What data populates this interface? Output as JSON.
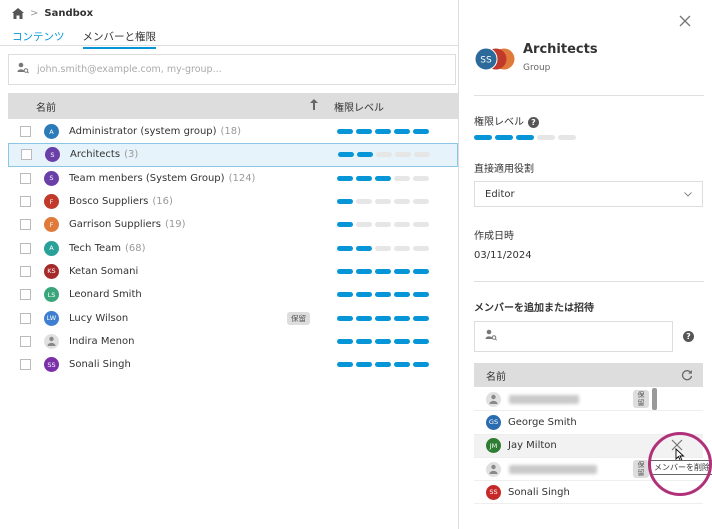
{
  "breadcrumb": {
    "current": "Sandbox"
  },
  "tabs": [
    {
      "label": "コンテンツ"
    },
    {
      "label": "メンバーと権限"
    }
  ],
  "search": {
    "placeholder": "john.smith@example.com, my-group..."
  },
  "table": {
    "col_name": "名前",
    "col_permission": "権限レベル",
    "rows": [
      {
        "initials": "A",
        "name": "Administrator (system group)",
        "count": "(18)",
        "avatar_color": "#2b7bb9",
        "group": true,
        "level": 5,
        "tag": ""
      },
      {
        "initials": "S",
        "name": "Architects",
        "count": "(3)",
        "avatar_color": "#6a3fa8",
        "group": true,
        "level": 2,
        "tag": ""
      },
      {
        "initials": "S",
        "name": "Team menbers (System Group)",
        "count": "(124)",
        "avatar_color": "#6a3fa8",
        "group": true,
        "level": 3,
        "tag": ""
      },
      {
        "initials": "F",
        "name": "Bosco Suppliers",
        "count": "(16)",
        "avatar_color": "#c0392b",
        "group": true,
        "level": 1,
        "tag": ""
      },
      {
        "initials": "F",
        "name": "Garrison Suppliers",
        "count": "(19)",
        "avatar_color": "#e07a3a",
        "group": true,
        "level": 1,
        "tag": ""
      },
      {
        "initials": "A",
        "name": "Tech Team",
        "count": "(68)",
        "avatar_color": "#2aa198",
        "group": true,
        "level": 2,
        "tag": ""
      },
      {
        "initials": "KS",
        "name": "Ketan Somani",
        "count": "",
        "avatar_color": "#a52a2a",
        "group": false,
        "level": 5,
        "tag": ""
      },
      {
        "initials": "LS",
        "name": "Leonard Smith",
        "count": "",
        "avatar_color": "#3aa57a",
        "group": false,
        "level": 5,
        "tag": ""
      },
      {
        "initials": "LW",
        "name": "Lucy Wilson",
        "count": "",
        "avatar_color": "#3f7fd1",
        "group": false,
        "level": 5,
        "tag": "保留"
      },
      {
        "initials": "",
        "name": "Indira Menon",
        "count": "",
        "avatar_color": "#e0e0e0",
        "group": false,
        "level": 5,
        "tag": ""
      },
      {
        "initials": "SS",
        "name": "Sonali Singh",
        "count": "",
        "avatar_color": "#7b2fa8",
        "group": false,
        "level": 5,
        "tag": ""
      }
    ]
  },
  "panel": {
    "title": "Architects",
    "subtitle": "Group",
    "avatar_initials": "SS",
    "permission_label": "権限レベル",
    "permission_level": 3,
    "role_label": "直接適用役割",
    "role_value": "Editor",
    "created_label": "作成日時",
    "created_value": "03/11/2024",
    "add_label": "メンバーを追加または招待",
    "members_col": "名前",
    "members": [
      {
        "initials": "",
        "name": "",
        "blurred": true,
        "tag": "保留"
      },
      {
        "initials": "GS",
        "name": "George Smith",
        "color": "#2b6cb0"
      },
      {
        "initials": "JM",
        "name": "Jay Milton",
        "color": "#2e7d32"
      },
      {
        "initials": "",
        "name": "",
        "blurred": true,
        "tag": "保留"
      },
      {
        "initials": "SS",
        "name": "Sonali Singh",
        "color": "#c62828"
      }
    ],
    "tooltip": "メンバーを削除"
  }
}
